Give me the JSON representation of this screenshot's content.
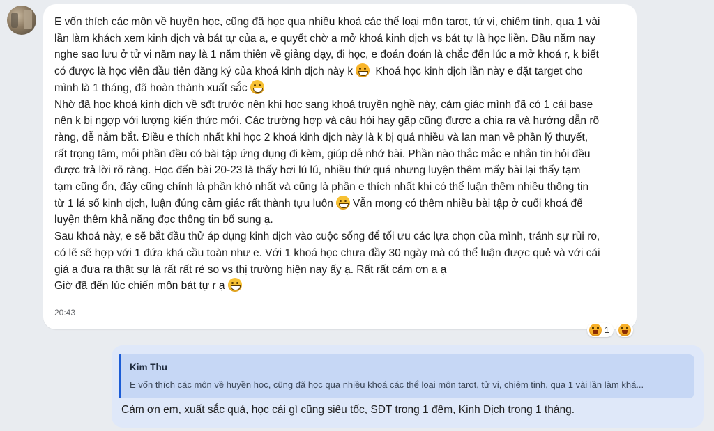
{
  "sender": {
    "avatar_icon": "user-avatar"
  },
  "message": {
    "lines": [
      "E vốn thích các môn về huyền học, cũng đã học qua nhiều khoá các thể loại môn tarot, tử vi, chiêm tinh, qua 1 vài",
      "lần làm khách xem kinh dịch và bát tự của a, e quyết chờ a mở khoá kinh dịch vs bát tự là học liền. Đầu năm nay",
      "nghe sao lưu ở tử vi năm nay là 1 năm thiên về giảng dạy, đi học, e đoán đoán là chắc đến lúc a mở khoá r, k biết",
      "có được là học viên đầu tiên đăng ký của khoá kinh dịch này k",
      "mình là 1 tháng, đã hoàn thành xuất sắc",
      "Nhờ đã học khoá kinh dịch về sđt trước nên khi học sang khoá truyền nghề này, cảm giác mình đã có 1 cái base",
      "nên k bị ngợp với lượng kiến thức mới. Các trường hợp và câu hỏi hay gặp cũng được a chia ra và hướng dẫn rõ",
      "ràng, dễ nắm bắt. Điều e thích nhất khi học 2 khoá kinh dịch này là k bị quá nhiều và lan man về phần lý thuyết,",
      "rất trọng tâm, mỗi phần đều có bài tập ứng dụng đi kèm, giúp dễ nhớ bài. Phần nào thắc mắc e nhắn tin hỏi đều",
      "được trả lời rõ ràng. Học đến bài 20-23 là thấy hơi lú lú, nhiều thứ quá nhưng luyện thêm mấy bài lại thấy tạm",
      "tạm cũng ổn, đây cũng chính là phần khó nhất và cũng là phần e thích nhất khi có thể luận thêm nhiều thông tin",
      "từ 1 lá số kinh dịch, luận đúng cảm giác rất thành tựu luôn",
      "luyện thêm khả năng đọc thông tin bổ sung ạ.",
      "Sau khoá này, e sẽ bắt đầu thử áp dụng kinh dịch vào cuộc sống để tối ưu các lựa chọn của mình, tránh sự rủi ro,",
      "có lẽ sẽ hợp với 1 đứa khá cầu toàn như e. Với 1 khoá học chưa đầy 30 ngày mà có thể luận được quẻ và với cái",
      "giá a đưa ra thật sự là rất rất rẻ so vs thị trường hiện nay ấy ạ. Rất rất cảm ơn a ạ",
      "Giờ đã đến lúc chiến môn bát tự r ạ"
    ],
    "line4_tail": "Khoá học kinh dịch lần này e đặt target cho",
    "line12_tail": "Vẫn mong có thêm nhiều bài tập ở cuối khoá để",
    "time": "20:43",
    "emoji_icon": "grinning-face-icon",
    "laugh_icon": "laughing-face-icon"
  },
  "reactions": {
    "count": "1",
    "icon": "laughing-face-icon"
  },
  "reply": {
    "quote_name": "Kim Thu",
    "quote_text": "E vốn thích các môn về huyền học, cũng đã học qua nhiều khoá các thể loại môn tarot, tử vi, chiêm tinh, qua 1 vài lần làm khá...",
    "text": "Cảm ơn em, xuất sắc quá, học cái gì cũng siêu tốc, SĐT trong 1 đêm, Kinh Dịch trong 1 tháng."
  },
  "colors": {
    "background": "#e9ecf0",
    "incoming_bubble": "#ffffff",
    "outgoing_bubble": "#dfe8f9",
    "quote_bg": "#c6d7f5",
    "quote_bar": "#1a5bd6"
  }
}
